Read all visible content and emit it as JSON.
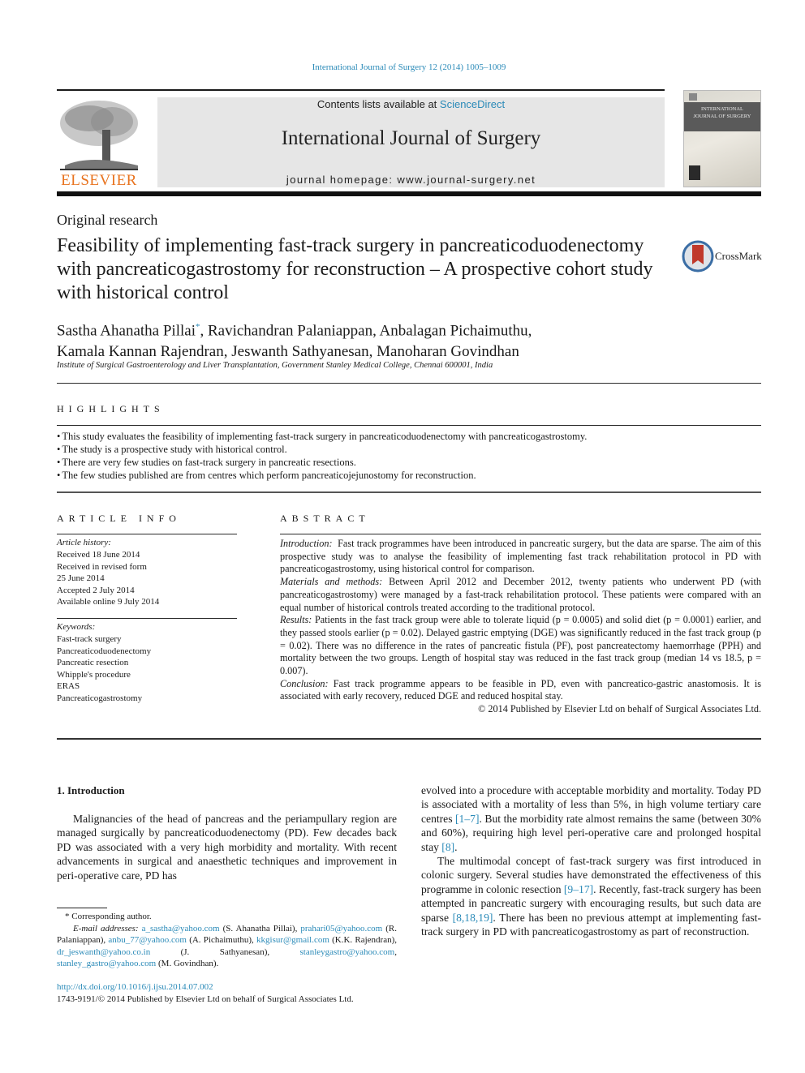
{
  "running_head": "International Journal of Surgery 12 (2014) 1005–1009",
  "masthead": {
    "publisher": "ELSEVIER",
    "contents_prefix": "Contents lists available at ",
    "contents_link": "ScienceDirect",
    "journal_name": "International Journal of Surgery",
    "homepage": "journal homepage: www.journal-surgery.net",
    "cover_title_line1": "INTERNATIONAL",
    "cover_title_line2": "JOURNAL OF SURGERY",
    "crossmark": "CrossMark"
  },
  "article": {
    "type": "Original research",
    "title": "Feasibility of implementing fast-track surgery in pancreaticoduodenectomy with pancreaticogastrostomy for reconstruction – A prospective cohort study with historical control",
    "authors_line1_a": "Sastha Ahanatha Pillai",
    "corresponding_mark": "*",
    "authors_line1_b": ", Ravichandran Palaniappan, Anbalagan Pichaimuthu,",
    "authors_line2": "Kamala Kannan Rajendran, Jeswanth Sathyanesan, Manoharan Govindhan",
    "affiliation": "Institute of Surgical Gastroenterology and Liver Transplantation, Government Stanley Medical College, Chennai 600001, India"
  },
  "highlights": {
    "heading": "HIGHLIGHTS",
    "items": [
      "This study evaluates the feasibility of implementing fast-track surgery in pancreaticoduodenectomy with pancreaticogastrostomy.",
      "The study is a prospective study with historical control.",
      "There are very few studies on fast-track surgery in pancreatic resections.",
      "The few studies published are from centres which perform pancreaticojejunostomy for reconstruction."
    ]
  },
  "article_info": {
    "heading": "ARTICLE INFO",
    "history_label": "Article history:",
    "history": [
      "Received 18 June 2014",
      "Received in revised form",
      "25 June 2014",
      "Accepted 2 July 2014",
      "Available online 9 July 2014"
    ],
    "keywords_label": "Keywords:",
    "keywords": [
      "Fast-track surgery",
      "Pancreaticoduodenectomy",
      "Pancreatic resection",
      "Whipple's procedure",
      "ERAS",
      "Pancreaticogastrostomy"
    ]
  },
  "abstract": {
    "heading": "ABSTRACT",
    "sections": [
      {
        "label": "Introduction:",
        "text": "  Fast track programmes have been introduced in pancreatic surgery, but the data are sparse. The aim of this prospective study was to analyse the feasibility of implementing fast track rehabilitation protocol in PD with pancreaticogastrostomy, using historical control for comparison."
      },
      {
        "label": "Materials and methods:",
        "text": " Between April 2012 and December 2012, twenty patients who underwent PD (with pancreaticogastrostomy) were managed by a fast-track rehabilitation protocol. These patients were compared with an equal number of historical controls treated according to the traditional protocol."
      },
      {
        "label": "Results:",
        "text": " Patients in the fast track group were able to tolerate liquid (p = 0.0005) and solid diet (p = 0.0001) earlier, and they passed stools earlier (p = 0.02). Delayed gastric emptying (DGE) was significantly reduced in the fast track group (p = 0.02). There was no difference in the rates of pancreatic fistula (PF), post pancreatectomy haemorrhage (PPH) and mortality between the two groups. Length of hospital stay was reduced in the fast track group (median 14 vs 18.5, p = 0.007)."
      },
      {
        "label": "Conclusion:",
        "text": " Fast track programme appears to be feasible in PD, even with pancreatico-gastric anastomosis. It is associated with early recovery, reduced DGE and reduced hospital stay."
      }
    ],
    "copyright": "© 2014 Published by Elsevier Ltd on behalf of Surgical Associates Ltd."
  },
  "body": {
    "intro_heading": "1.  Introduction",
    "left_p1": "Malignancies of the head of pancreas and the periampullary region are managed surgically by pancreaticoduodenectomy (PD). Few decades back PD was associated with a very high morbidity and mortality. With recent advancements in surgical and anaesthetic techniques and improvement in peri-operative care, PD has",
    "right_p1_a": "evolved into a procedure with acceptable morbidity and mortality. Today PD is associated with a mortality of less than 5%, in high volume tertiary care centres ",
    "right_p1_ref1": "[1–7]",
    "right_p1_b": ". But the morbidity rate almost remains the same (between 30% and 60%), requiring high level peri-operative care and prolonged hospital stay ",
    "right_p1_ref2": "[8]",
    "right_p1_c": ".",
    "right_p2_a": "The multimodal concept of fast-track surgery was first introduced in colonic surgery. Several studies have demonstrated the effectiveness of this programme in colonic resection ",
    "right_p2_ref1": "[9–17]",
    "right_p2_b": ". Recently, fast-track surgery has been attempted in pancreatic surgery with encouraging results, but such data are sparse ",
    "right_p2_ref2": "[8,18,19]",
    "right_p2_c": ". There has been no previous attempt at implementing fast-track surgery in PD with pancreaticogastrostomy as part of reconstruction."
  },
  "footnotes": {
    "corresponding": "* Corresponding author.",
    "email_label": "E-mail addresses:",
    "emails": [
      {
        "email": "a_sastha@yahoo.com",
        "name": " (S. Ahanatha Pillai), "
      },
      {
        "email": "prahari05@yahoo.com",
        "name": " (R. Palaniappan), "
      },
      {
        "email": "anbu_77@yahoo.com",
        "name": " (A. Pichaimuthu), "
      },
      {
        "email": "kkgisur@gmail.com",
        "name": " (K.K. Rajendran), "
      },
      {
        "email": "dr_jeswanth@yahoo.co.in",
        "name": " (J. Sathyanesan), "
      },
      {
        "email": "stanleygastro@yahoo.com",
        "name": ", "
      },
      {
        "email": "stanley_gastro@yahoo.com",
        "name": " (M. Govindhan)."
      }
    ],
    "doi": "http://dx.doi.org/10.1016/j.ijsu.2014.07.002",
    "issn": "1743-9191/© 2014 Published by Elsevier Ltd on behalf of Surgical Associates Ltd."
  },
  "colors": {
    "link": "#2a8ab8",
    "elsevier_orange": "#e8731e",
    "masthead_bg": "#e6e6e6",
    "crossmark_red": "#c0392b"
  }
}
